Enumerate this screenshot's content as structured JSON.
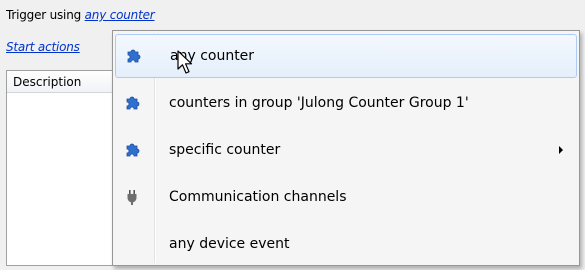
{
  "trigger": {
    "prefix": "Trigger using",
    "link": "any counter"
  },
  "start": {
    "link": "Start actions"
  },
  "list": {
    "column_header": "Description"
  },
  "menu": {
    "items": [
      {
        "label": "any counter",
        "icon": "puzzle-piece-icon",
        "highlighted": true
      },
      {
        "label": "counters in group 'Julong Counter Group 1'",
        "icon": "puzzle-piece-icon"
      },
      {
        "label": "specific counter",
        "icon": "puzzle-piece-icon",
        "submenu": true
      },
      {
        "label": "Communication channels",
        "icon": "plug-icon"
      },
      {
        "label": "any device event",
        "icon": ""
      }
    ]
  },
  "colors": {
    "link": "#0033cc",
    "highlight_border": "#aeccf1",
    "icon_blue": "#2f6fd0"
  }
}
